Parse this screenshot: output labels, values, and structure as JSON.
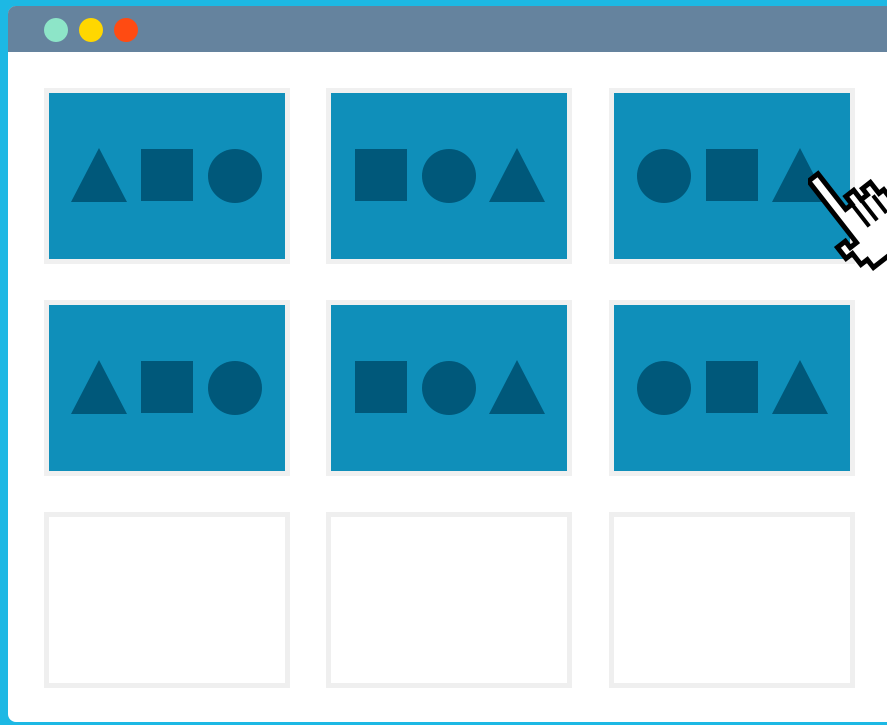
{
  "window": {
    "traffic_lights": [
      {
        "name": "green-dot",
        "color": "#8de5c8"
      },
      {
        "name": "yellow-dot",
        "color": "#ffd700"
      },
      {
        "name": "red-dot",
        "color": "#ff4b12"
      }
    ]
  },
  "grid": {
    "tile_color": "#0f8fba",
    "shape_color": "#00587a",
    "tiles": [
      {
        "filled": true,
        "shapes": [
          "triangle",
          "square",
          "circle"
        ]
      },
      {
        "filled": true,
        "shapes": [
          "square",
          "circle",
          "triangle"
        ]
      },
      {
        "filled": true,
        "shapes": [
          "circle",
          "square",
          "triangle"
        ]
      },
      {
        "filled": true,
        "shapes": [
          "triangle",
          "square",
          "circle"
        ]
      },
      {
        "filled": true,
        "shapes": [
          "square",
          "circle",
          "triangle"
        ]
      },
      {
        "filled": true,
        "shapes": [
          "circle",
          "square",
          "triangle"
        ]
      },
      {
        "filled": false,
        "shapes": []
      },
      {
        "filled": false,
        "shapes": []
      },
      {
        "filled": false,
        "shapes": []
      }
    ]
  },
  "cursor": {
    "icon": "hand-pointer-icon"
  }
}
